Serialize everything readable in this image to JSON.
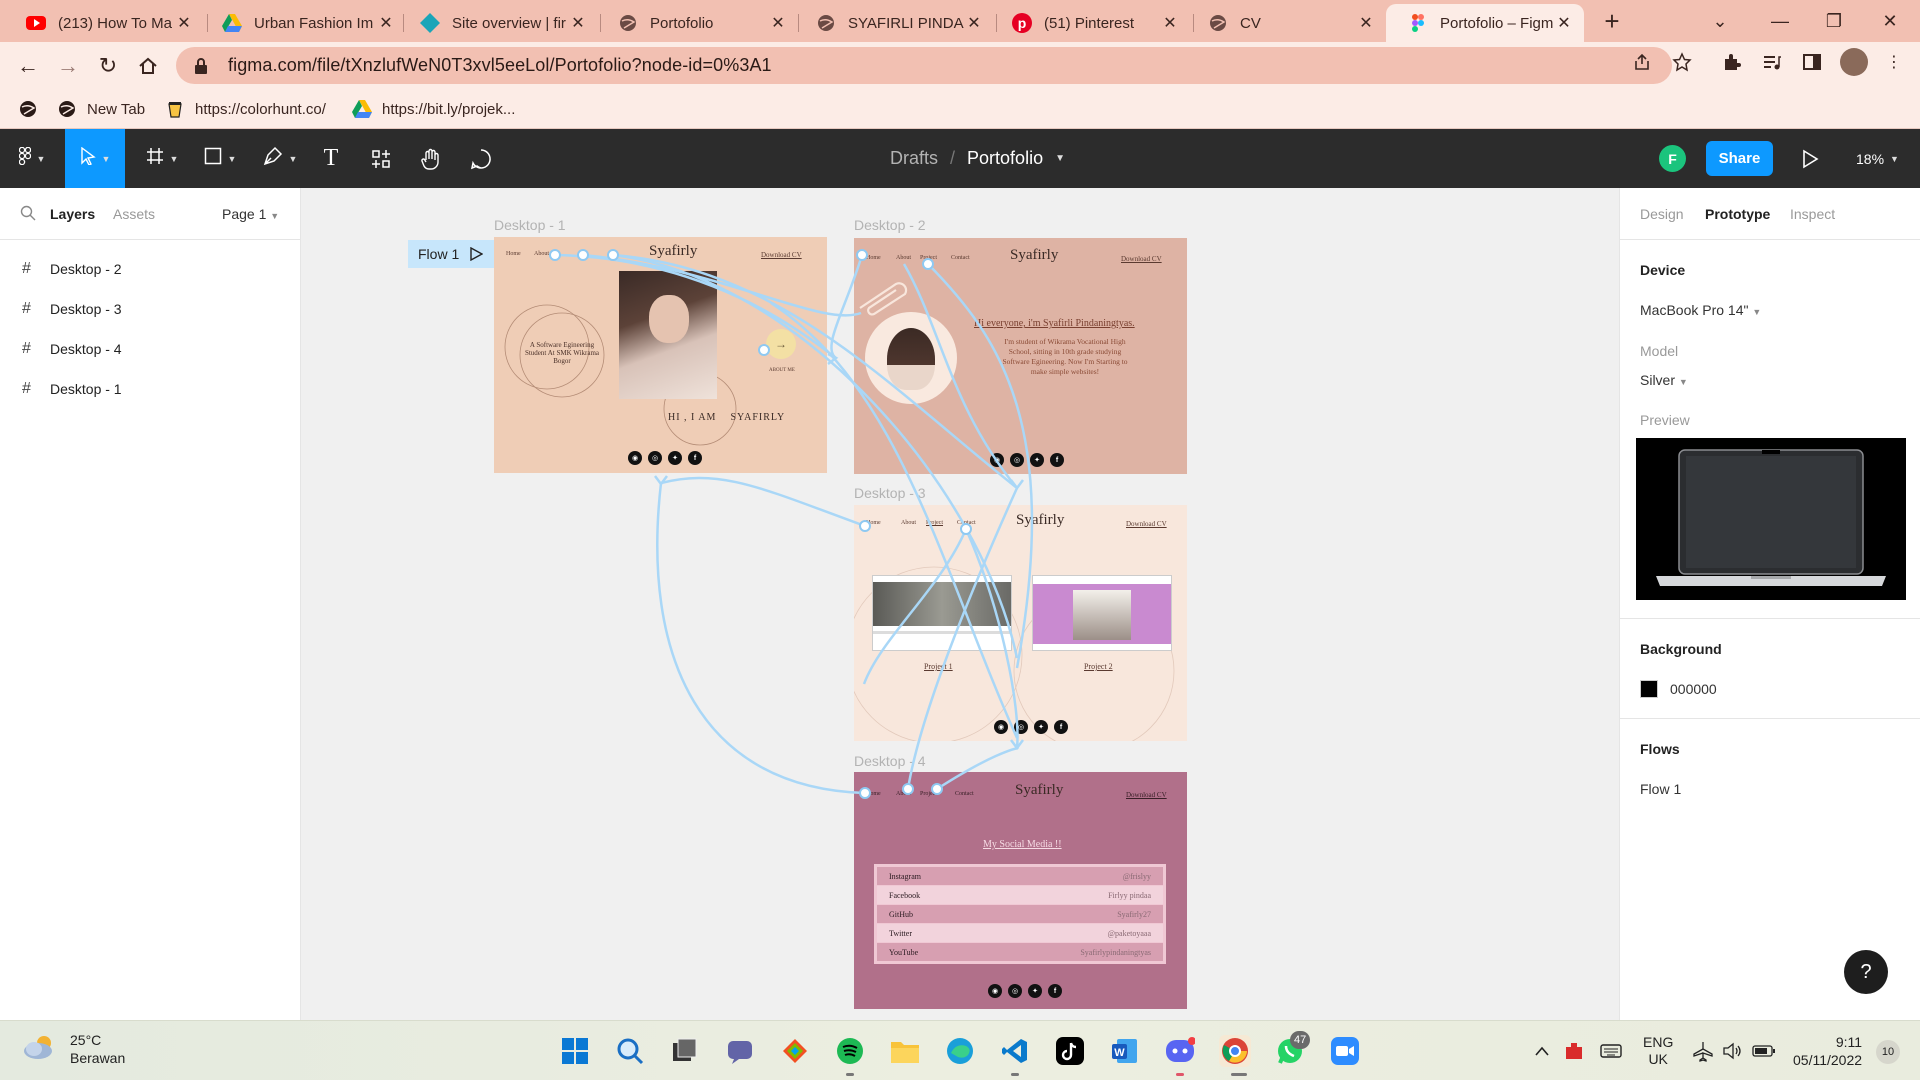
{
  "browser": {
    "tabs": [
      {
        "title": "(213) How To Ma",
        "icon": "youtube-icon"
      },
      {
        "title": "Urban Fashion Im",
        "icon": "google-drive-icon"
      },
      {
        "title": "Site overview | fir",
        "icon": "site-diamond-icon"
      },
      {
        "title": "Portofolio",
        "icon": "globe-icon"
      },
      {
        "title": "SYAFIRLI PINDAN",
        "icon": "globe-icon"
      },
      {
        "title": "(51) Pinterest",
        "icon": "pinterest-icon"
      },
      {
        "title": "CV",
        "icon": "globe-icon"
      },
      {
        "title": "Portofolio – Figm",
        "icon": "figma-icon",
        "active": true
      }
    ],
    "url": "figma.com/file/tXnzlufWeN0T3xvl5eeLol/Portofolio?node-id=0%3A1",
    "bookmarks": [
      {
        "label": "",
        "icon": "globe-icon"
      },
      {
        "label": "New Tab",
        "icon": "globe-icon"
      },
      {
        "label": "https://colorhunt.co/",
        "icon": "colorhunt-icon"
      },
      {
        "label": "https://bit.ly/projek...",
        "icon": "google-drive-icon"
      }
    ]
  },
  "figma": {
    "breadcrumb": {
      "drafts": "Drafts",
      "separator": "/",
      "file": "Portofolio"
    },
    "avatar_initial": "F",
    "share_label": "Share",
    "zoom": "18%",
    "left_panel": {
      "tabs": {
        "layers": "Layers",
        "assets": "Assets"
      },
      "page": "Page 1",
      "layers": [
        "Desktop - 2",
        "Desktop - 3",
        "Desktop - 4",
        "Desktop - 1"
      ]
    },
    "canvas": {
      "flow_tag": "Flow 1",
      "frames": {
        "d1": {
          "label": "Desktop - 1",
          "logo": "Syafirly",
          "nav": [
            "Home",
            "About"
          ],
          "download": "Download CV",
          "circle_text": "A Software Egineering Student At SMK Wikrama Bogor",
          "headline": "HI , I AM    SYAFIRLY",
          "about_link": "ABOUT ME",
          "bg": "#efcdb6"
        },
        "d2": {
          "label": "Desktop - 2",
          "logo": "Syafirly",
          "nav": [
            "Home",
            "About",
            "Project",
            "Contact"
          ],
          "download": "Download CV",
          "greeting": "Hi everyone, i'm Syafirli Pindaningtyas.",
          "body": "I'm student of Wikrama Vocational High School, sitting in 10th grade studying Software Egineering. Now I'm Starting to make simple websites!",
          "bg": "#deb3a4"
        },
        "d3": {
          "label": "Desktop - 3",
          "logo": "Syafirly",
          "nav": [
            "Home",
            "About",
            "Project",
            "Contact"
          ],
          "download": "Download CV",
          "project1": "Project 1",
          "project2": "Project 2",
          "bg": "#f8e7dc"
        },
        "d4": {
          "label": "Desktop - 4",
          "logo": "Syafirly",
          "nav": [
            "Home",
            "About",
            "Project",
            "Contact"
          ],
          "download": "Download CV",
          "heading": "My Social Media !!",
          "rows": [
            {
              "name": "Instagram",
              "handle": "@frislyy"
            },
            {
              "name": "Facebook",
              "handle": "Firlyy pindaa"
            },
            {
              "name": "GitHub",
              "handle": "Syafirly27"
            },
            {
              "name": "Twitter",
              "handle": "@paketoyaaa"
            },
            {
              "name": "YouTube",
              "handle": "Syafirlypindaningtyas"
            }
          ],
          "bg": "#b1708a"
        }
      }
    },
    "right_panel": {
      "tabs": {
        "design": "Design",
        "prototype": "Prototype",
        "inspect": "Inspect"
      },
      "device_heading": "Device",
      "device": "MacBook Pro 14\"",
      "model_label": "Model",
      "model": "Silver",
      "preview_label": "Preview",
      "background_heading": "Background",
      "background_hex": "000000",
      "flows_heading": "Flows",
      "flow": "Flow 1",
      "help": "?"
    }
  },
  "taskbar": {
    "weather_temp": "25°C",
    "weather_desc": "Berawan",
    "lang": "ENG",
    "region": "UK",
    "time": "9:11",
    "date": "05/11/2022",
    "notif_count": "10",
    "whatsapp_badge": "47"
  },
  "colors": {
    "figma_blue": "#0d99ff",
    "flow_blue": "#a9d7f7",
    "tab_bar": "#f2c0b2"
  }
}
